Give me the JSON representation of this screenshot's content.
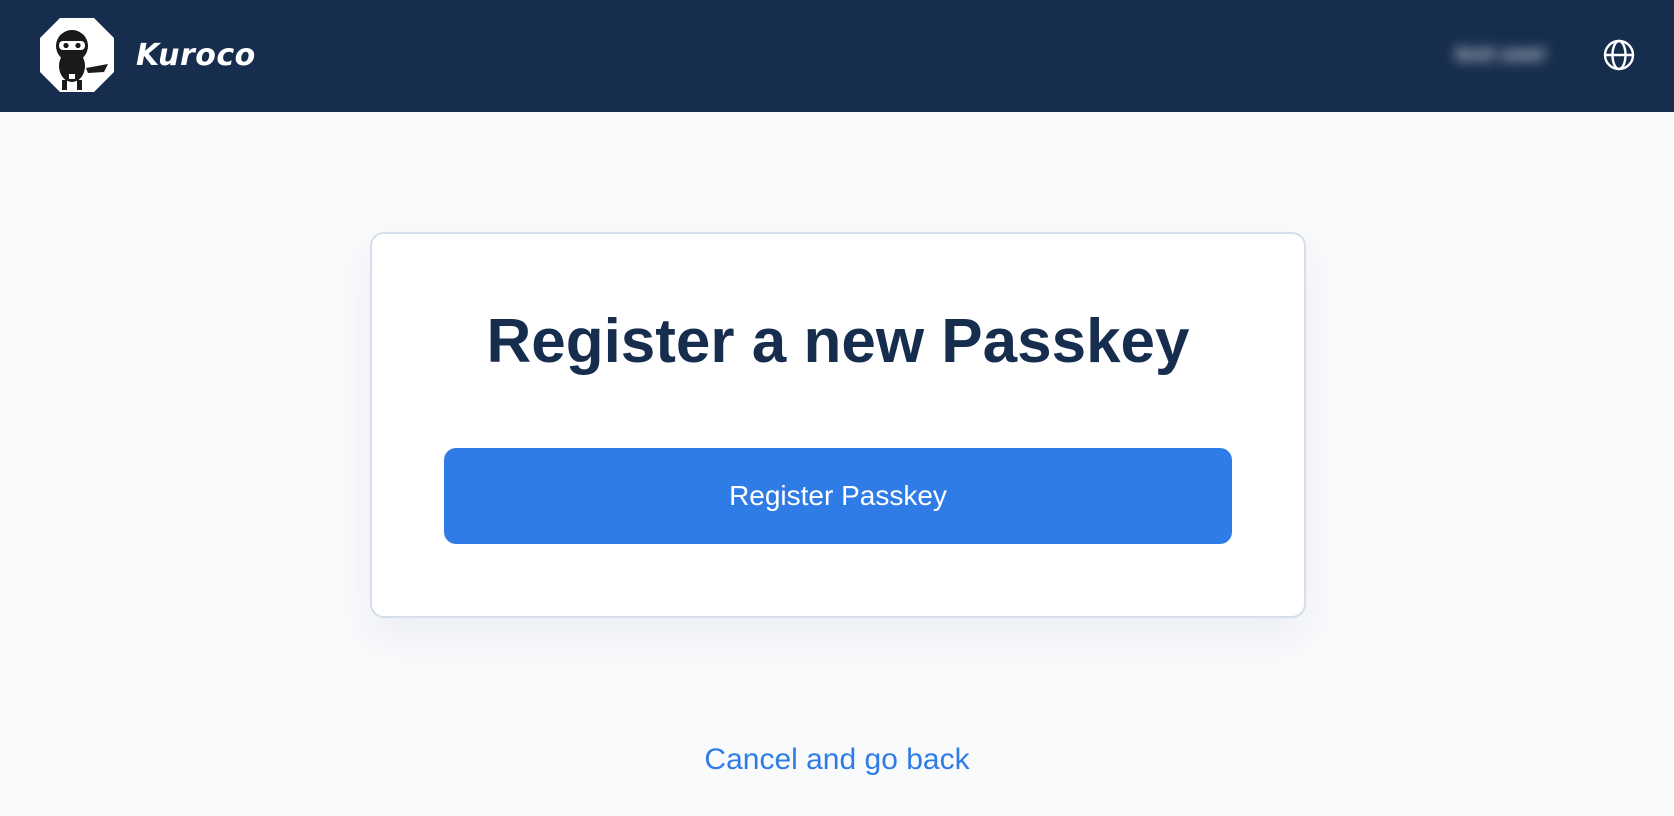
{
  "header": {
    "brand": "Kuroco",
    "logo_icon": "ninja-logo-icon",
    "language_icon": "globe-icon",
    "user_name": "test user",
    "bg_color": "#172d4e"
  },
  "main": {
    "title": "Register a new Passkey",
    "register_button_label": "Register Passkey",
    "cancel_link_label": "Cancel and go back",
    "accent_color": "#2f7ce6"
  }
}
